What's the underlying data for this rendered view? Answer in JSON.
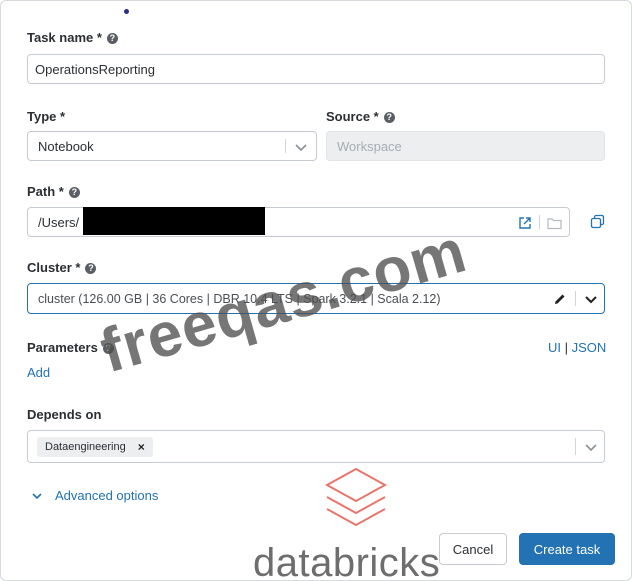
{
  "task_name": {
    "label": "Task name *",
    "value": "OperationsReporting"
  },
  "type": {
    "label": "Type *",
    "value": "Notebook"
  },
  "source": {
    "label": "Source *",
    "value": "Workspace"
  },
  "path": {
    "label": "Path *",
    "value": "/Users/"
  },
  "cluster": {
    "label": "Cluster *",
    "value": "cluster (126.00 GB | 36 Cores | DBR 10.4 LTS | Spark 3.2.1 | Scala 2.12)"
  },
  "parameters": {
    "label": "Parameters",
    "ui_link": "UI",
    "divider": "|",
    "json_link": "JSON",
    "add_link": "Add"
  },
  "depends_on": {
    "label": "Depends on",
    "chip": "Dataengineering",
    "chip_remove": "×"
  },
  "advanced": {
    "label": "Advanced options"
  },
  "buttons": {
    "cancel": "Cancel",
    "create": "Create task"
  },
  "watermark": {
    "site": "freeqas.com",
    "brand": "databricks"
  },
  "colors": {
    "link": "#2272b4",
    "primary": "#2272b4",
    "focus_border": "#2272b4",
    "brand_logo": "#e8756a"
  }
}
